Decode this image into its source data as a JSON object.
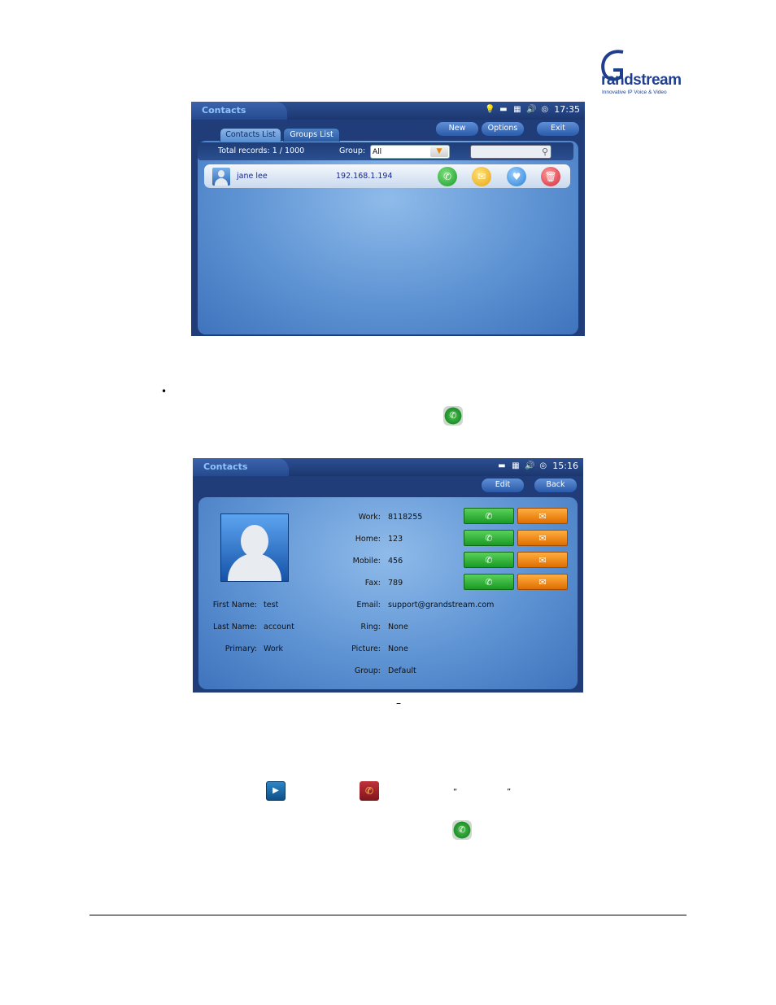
{
  "logo": {
    "brand": "randstream",
    "tagline": "Innovative IP Voice & Video"
  },
  "screen1": {
    "app_title": "Contacts",
    "clock": "17:35",
    "buttons": {
      "new": "New",
      "options": "Options",
      "exit": "Exit"
    },
    "tabs": {
      "contacts": "Contacts List",
      "groups": "Groups List"
    },
    "total_records": "Total records: 1 / 1000",
    "group_label": "Group:",
    "group_value": "All",
    "contact": {
      "name": "jane lee",
      "ip": "192.168.1.194"
    }
  },
  "screen2": {
    "app_title": "Contacts",
    "clock": "15:16",
    "buttons": {
      "edit": "Edit",
      "back": "Back"
    },
    "left_fields": [
      {
        "label": "First Name:",
        "value": "test"
      },
      {
        "label": "Last Name:",
        "value": "account"
      },
      {
        "label": "Primary:",
        "value": "Work"
      }
    ],
    "phone_fields": [
      {
        "label": "Work:",
        "value": "8118255"
      },
      {
        "label": "Home:",
        "value": "123"
      },
      {
        "label": "Mobile:",
        "value": "456"
      },
      {
        "label": "Fax:",
        "value": "789"
      }
    ],
    "other_fields": [
      {
        "label": "Email:",
        "value": "support@grandstream.com"
      },
      {
        "label": "Ring:",
        "value": "None"
      },
      {
        "label": "Picture:",
        "value": "None"
      },
      {
        "label": "Group:",
        "value": "Default"
      }
    ]
  },
  "doc": {
    "bullet": "•",
    "dash": "–",
    "open_quote": "“",
    "close_quote": "”"
  }
}
